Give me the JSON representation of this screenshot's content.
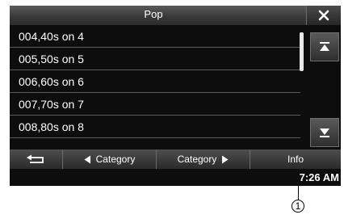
{
  "header": {
    "title": "Pop"
  },
  "list": {
    "items": [
      {
        "label": "004,40s on 4"
      },
      {
        "label": "005,50s on 5"
      },
      {
        "label": "006,60s on 6"
      },
      {
        "label": "007,70s on 7"
      },
      {
        "label": "008,80s on 8"
      }
    ]
  },
  "footer": {
    "back_label": "",
    "prev_category_label": "Category",
    "next_category_label": "Category",
    "info_label": "Info"
  },
  "status": {
    "time": "7:26 AM"
  },
  "annotation": {
    "callout": "1"
  },
  "icons": {
    "close": "close-icon",
    "scroll_top": "scroll-to-top-icon",
    "scroll_bottom": "scroll-to-bottom-icon",
    "back": "back-arrow-icon",
    "prev": "triangle-left-icon",
    "next": "triangle-right-icon"
  }
}
